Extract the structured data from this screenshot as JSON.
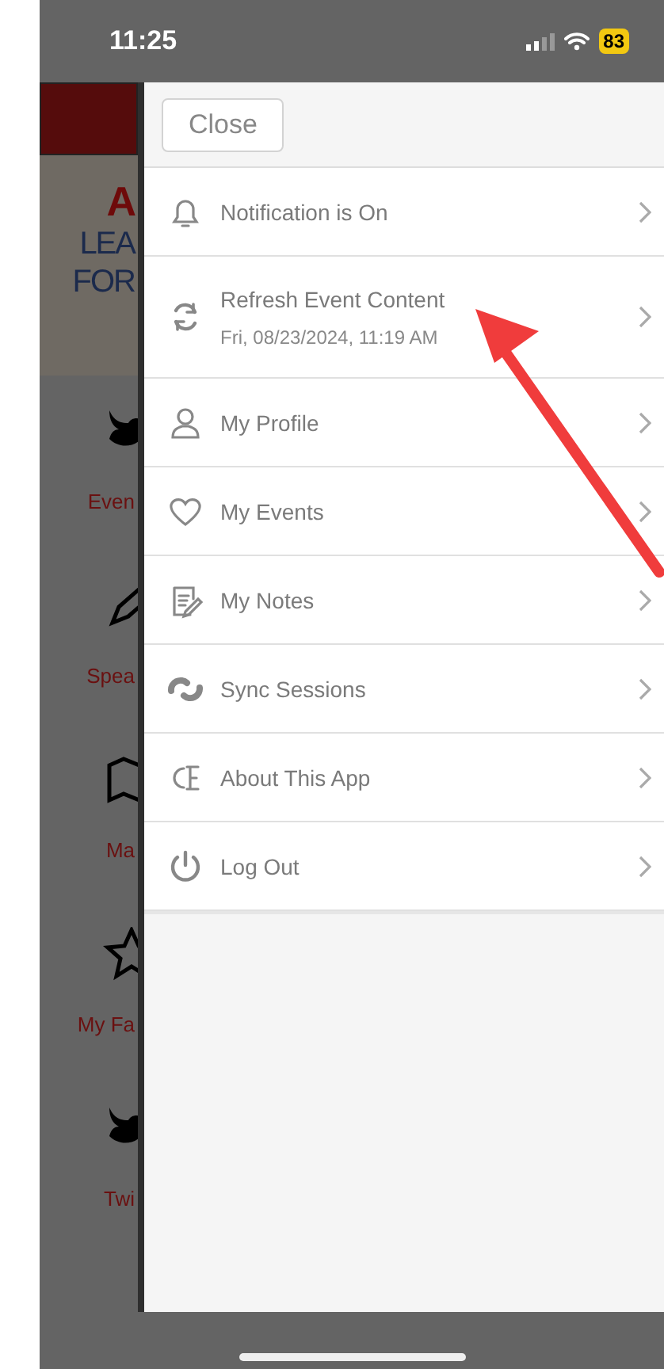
{
  "status_bar": {
    "time": "11:25",
    "battery": "83"
  },
  "background_app": {
    "banner_lines": [
      "A",
      "LEA",
      "FOR"
    ],
    "tiles": [
      {
        "label": "Even"
      },
      {
        "label": "Spea"
      },
      {
        "label": "Ma"
      },
      {
        "label": "My Fa"
      },
      {
        "label": "Twi"
      }
    ]
  },
  "menu": {
    "close_button": "Close",
    "items": [
      {
        "label": "Notification is On"
      },
      {
        "label": "Refresh Event Content",
        "subtitle": "Fri, 08/23/2024, 11:19 AM"
      },
      {
        "label": "My Profile"
      },
      {
        "label": "My Events"
      },
      {
        "label": "My Notes"
      },
      {
        "label": "Sync Sessions"
      },
      {
        "label": "About This App"
      },
      {
        "label": "Log Out"
      }
    ]
  }
}
